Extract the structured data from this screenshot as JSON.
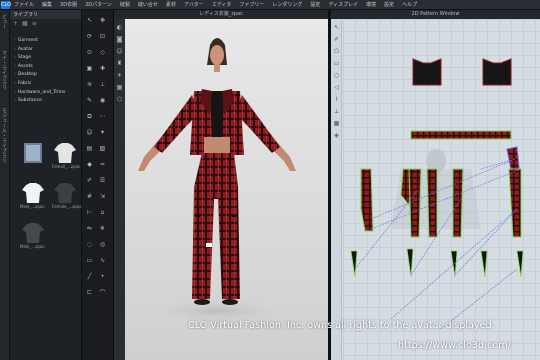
{
  "app": {
    "logo": "CLO"
  },
  "menu": [
    "ファイル",
    "編集",
    "3D衣服",
    "2Dパターン",
    "縫製",
    "縫い合せ",
    "素材",
    "アバター",
    "エディタ",
    "ファブリー",
    "レンダリング",
    "設定",
    "ディスプレイ",
    "環境",
    "設定",
    "ヘルプ"
  ],
  "left_tabs": [
    "ビュー",
    "マイ・ライブラリ",
    "モジュール・ライブラリ"
  ],
  "library": {
    "title": "ライブラリ",
    "tree": [
      {
        "label": "Garment"
      },
      {
        "label": "Avatar"
      },
      {
        "label": "Stage"
      },
      {
        "label": "Assets"
      },
      {
        "label": "Desktop"
      },
      {
        "label": "Fabric"
      },
      {
        "label": "Hardware_and_Trims"
      },
      {
        "label": "Substance"
      }
    ],
    "thumbnails": [
      {
        "label": ""
      },
      {
        "label": "Femail_...zpac"
      },
      {
        "label": "Male_...zpac"
      },
      {
        "label": "Female_...zpac"
      },
      {
        "label": "Male_...zpac"
      }
    ]
  },
  "viewport": {
    "title": "レディス衣装_zpac"
  },
  "pattern_window": {
    "title": "2D Pattern Window"
  },
  "overlay": {
    "copyright": "CLO Virtual Fashion, Inc. owns all rights to the avatar displayed.",
    "url": "https://www.clo3d.com/"
  },
  "colors": {
    "plaid_red": "#8e1b1f",
    "plaid_dark": "#2a0d0f",
    "seam_green": "#7ed957",
    "seam_blue": "#6b6fe8"
  }
}
